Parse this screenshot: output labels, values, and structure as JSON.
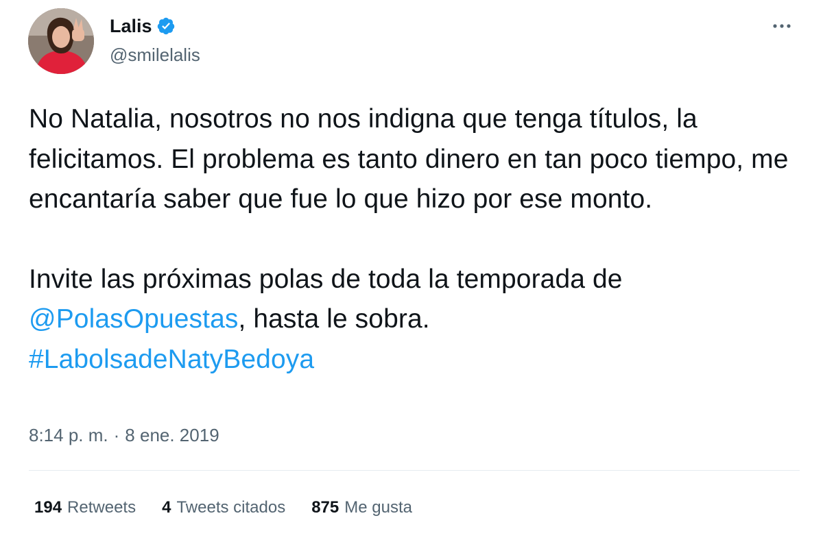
{
  "user": {
    "display_name": "Lalis",
    "handle": "@smilelalis",
    "verified": true,
    "avatar_icon": "profile-photo",
    "badge_color": "#1d9bf0"
  },
  "tweet": {
    "paragraph1": "No Natalia, nosotros no nos indigna que tenga títulos, la felicitamos. El problema es tanto dinero en tan poco tiempo, me encantaría saber que fue lo que hizo por ese monto.",
    "paragraph2_before": "Invite las próximas polas de toda la temporada de",
    "mention": "@PolasOpuestas",
    "paragraph2_after": ", hasta le sobra.",
    "hashtag": "#LabolsadeNatyBedoya"
  },
  "meta": {
    "time": "8:14 p. m.",
    "separator": "·",
    "date": "8 ene. 2019"
  },
  "stats": [
    {
      "count": "194",
      "label": "Retweets"
    },
    {
      "count": "4",
      "label": "Tweets citados"
    },
    {
      "count": "875",
      "label": "Me gusta"
    }
  ],
  "menu": {
    "icon": "more-horizontal-icon"
  }
}
